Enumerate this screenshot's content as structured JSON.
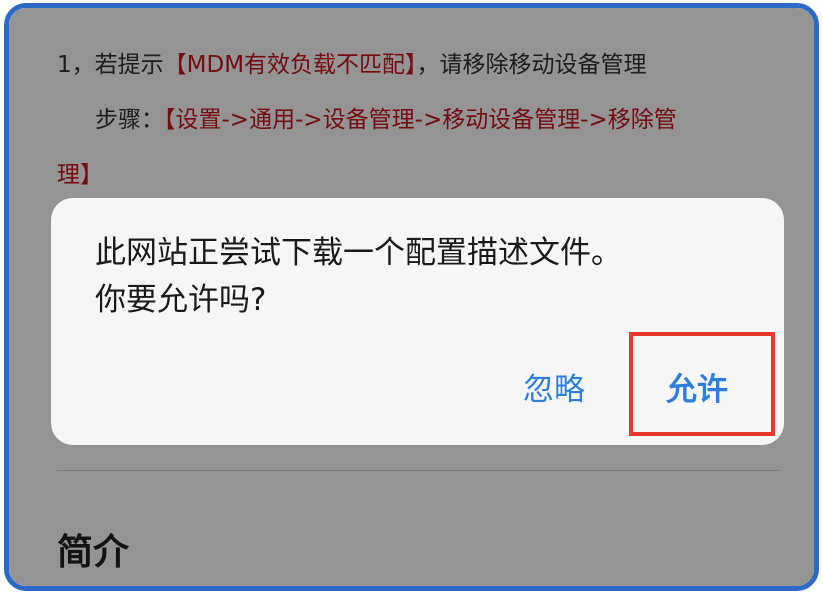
{
  "instructions": {
    "line1_prefix": "1，若提示",
    "line1_highlight": "【MDM有效负载不匹配】",
    "line1_suffix": "，请移除移动设备管理",
    "line2_prefix": "步骤：",
    "line2_highlight": "【设置->通用->设备管理->移动设备管理->移除管",
    "line3_highlight": "理】"
  },
  "background_row": {
    "col1": "",
    "col2": "",
    "col3": ""
  },
  "section": {
    "title": "简介"
  },
  "dialog": {
    "message_line1": "此网站正尝试下载一个配置描述文件。",
    "message_line2": "你要允许吗?",
    "ignore_label": "忽略",
    "allow_label": "允许"
  },
  "colors": {
    "frame_border": "#2a69c8",
    "highlight_text": "#c8161d",
    "button_blue": "#2c7de0",
    "annotation_box": "#e53a2a"
  }
}
